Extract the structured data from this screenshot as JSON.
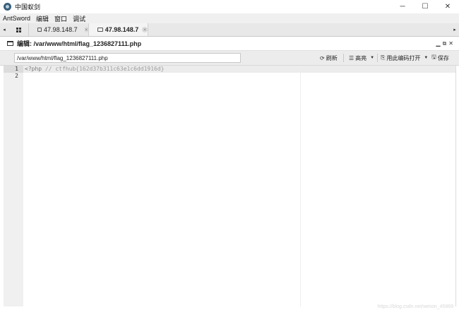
{
  "window": {
    "title": "中国蚁剑",
    "minimize": "─",
    "maximize": "☐",
    "close": "✕"
  },
  "menu": {
    "items": [
      "AntSword",
      "编辑",
      "窗口",
      "调试"
    ]
  },
  "tabs": {
    "left_arrow": "◂",
    "right_arrow": "▸",
    "items": [
      {
        "label": "47.98.148.7",
        "close": "✕"
      },
      {
        "label": "47.98.148.7",
        "close": "✕"
      }
    ]
  },
  "panel": {
    "title": "编辑: /var/www/html/flag_1236827111.php",
    "minimize": "▁",
    "restore": "⧉",
    "close": "✕"
  },
  "toolbar": {
    "path_value": "/var/www/html/flag_1236827111.php",
    "refresh_icon": "⟳",
    "refresh_label": "刷新",
    "highlight_icon": "☰",
    "highlight_label": "高亮",
    "highlight_caret": "▼",
    "encoding_icon": "⎘",
    "encoding_label": "用此编码打开",
    "encoding_caret": "▼",
    "save_icon": "🖫",
    "save_label": "保存"
  },
  "editor": {
    "line_numbers": [
      "1",
      "2"
    ],
    "line1_tag": "<?php",
    "line1_comment": " // ctfhub{162d37b311c63e1c6dd1916d}",
    "line2": ""
  },
  "watermark": "https://blog.csdn.net/weixin_45869"
}
